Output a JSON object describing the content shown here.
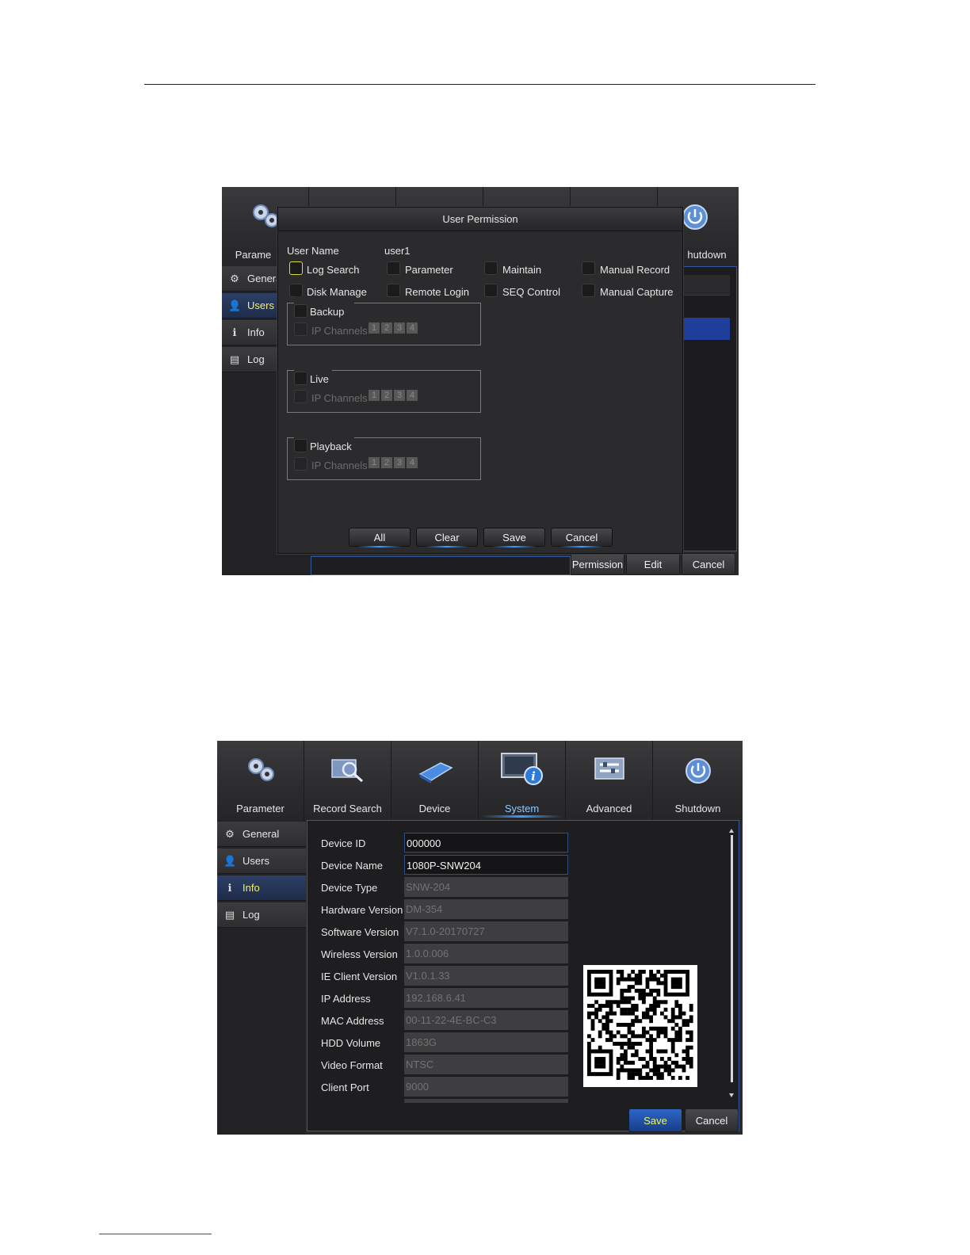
{
  "screen1": {
    "nav": [
      {
        "label": "Parame"
      },
      {
        "label": ""
      },
      {
        "label": ""
      },
      {
        "label": ""
      },
      {
        "label": ""
      },
      {
        "label": "hutdown"
      }
    ],
    "sidebar": [
      {
        "label": "Genera",
        "icon": "gear-icon"
      },
      {
        "label": "Users",
        "icon": "user-icon"
      },
      {
        "label": "Info",
        "icon": "info-icon"
      },
      {
        "label": "Log",
        "icon": "log-icon"
      }
    ],
    "dialog": {
      "title": "User Permission",
      "user_name_label": "User Name",
      "user_name_value": "user1",
      "permissions": [
        "Log Search",
        "Parameter",
        "Maintain",
        "Manual Record",
        "Disk Manage",
        "Remote Login",
        "SEQ Control",
        "Manual Capture"
      ],
      "groups": [
        {
          "label": "Backup",
          "channels_label": "IP Channels",
          "channels": [
            "1",
            "2",
            "3",
            "4"
          ]
        },
        {
          "label": "Live",
          "channels_label": "IP Channels",
          "channels": [
            "1",
            "2",
            "3",
            "4"
          ]
        },
        {
          "label": "Playback",
          "channels_label": "IP Channels",
          "channels": [
            "1",
            "2",
            "3",
            "4"
          ]
        }
      ],
      "buttons": {
        "all": "All",
        "clear": "Clear",
        "save": "Save",
        "cancel": "Cancel"
      }
    },
    "bottom_buttons": {
      "permission": "Permission",
      "edit": "Edit",
      "cancel": "Cancel"
    }
  },
  "screen2": {
    "nav": [
      {
        "label": "Parameter"
      },
      {
        "label": "Record Search"
      },
      {
        "label": "Device"
      },
      {
        "label": "System"
      },
      {
        "label": "Advanced"
      },
      {
        "label": "Shutdown"
      }
    ],
    "sidebar": [
      {
        "label": "General",
        "icon": "gear-icon"
      },
      {
        "label": "Users",
        "icon": "user-icon"
      },
      {
        "label": "Info",
        "icon": "info-icon"
      },
      {
        "label": "Log",
        "icon": "log-icon"
      }
    ],
    "fields": [
      {
        "label": "Device ID",
        "value": "000000"
      },
      {
        "label": "Device Name",
        "value": "1080P-SNW204"
      },
      {
        "label": "Device Type",
        "value": "SNW-204"
      },
      {
        "label": "Hardware Version",
        "value": "DM-354"
      },
      {
        "label": "Software Version",
        "value": "V7.1.0-20170727"
      },
      {
        "label": "Wireless Version",
        "value": "1.0.0.006"
      },
      {
        "label": "IE Client Version",
        "value": "V1.0.1.33"
      },
      {
        "label": "IP Address",
        "value": "192.168.6.41"
      },
      {
        "label": "MAC Address",
        "value": "00-11-22-4E-BC-C3"
      },
      {
        "label": "HDD Volume",
        "value": "1863G"
      },
      {
        "label": "Video Format",
        "value": "NTSC"
      },
      {
        "label": "Client Port",
        "value": "9000"
      }
    ],
    "buttons": {
      "save": "Save",
      "cancel": "Cancel"
    }
  }
}
